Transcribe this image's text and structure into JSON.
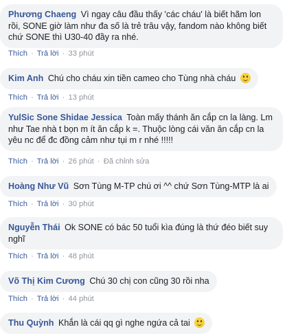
{
  "comments": [
    {
      "author": "Phương Chaeng",
      "text": "Vì ngay câu đầu thấy 'các cháu' là biết hãm lon rồi, SONE giờ làm như đa số là trẻ trâu vậy, fandom nào không biết chứ SONE thì U30-40 đầy ra nhé.",
      "like_label": "Thích",
      "reply_label": "Trả lời",
      "time": "33 phút",
      "edited": ""
    },
    {
      "author": "Kim Anh",
      "text": "Chú cho cháu xin tiền cameo cho Tùng nhà cháu",
      "emoji": "smiling-face-icon",
      "like_label": "Thích",
      "reply_label": "Trả lời",
      "time": "13 phút",
      "edited": ""
    },
    {
      "author": "YulSic Sone Shidae Jessica",
      "text": "Toàn mấy thánh ăn cắp cn la làng. Lm như Tae nhà t bọn m ít ăn cắp k =. Thuộc lòng cái văn ăn cắp cn la yêu nc để đc đồng cảm như tụi m r nhé !!!!!",
      "like_label": "Thích",
      "reply_label": "Trả lời",
      "time": "26 phút",
      "edited": "Đã chỉnh sửa"
    },
    {
      "author": "Hoàng Như Vũ",
      "text": "Sơn Tùng M-TP chú ơi ^^ chứ Sơn Tùng-MTP là ai",
      "like_label": "Thích",
      "reply_label": "Trả lời",
      "time": "30 phút",
      "edited": ""
    },
    {
      "author": "Nguyễn Thái",
      "text": "Ok SONE có bác 50 tuổi kìa đúng là thứ đéo biết suy nghĩ",
      "like_label": "Thích",
      "reply_label": "Trả lời",
      "time": "48 phút",
      "edited": ""
    },
    {
      "author": "Võ Thị Kim Cương",
      "text": "Chú 30 chị con cũng 30 rồi nha",
      "like_label": "Thích",
      "reply_label": "Trả lời",
      "time": "44 phút",
      "edited": ""
    },
    {
      "author": "Thu Quỳnh",
      "text": "Khắn là cái qq gì nghe ngứa cả tai",
      "emoji": "smiling-face-icon",
      "like_label": "Thích",
      "reply_label": "Trả lời",
      "time": "",
      "edited": ""
    }
  ],
  "separator": "·",
  "colors": {
    "bubble": "#f2f3f5",
    "author": "#385898",
    "text": "#1c1e21",
    "meta": "#90949c"
  }
}
